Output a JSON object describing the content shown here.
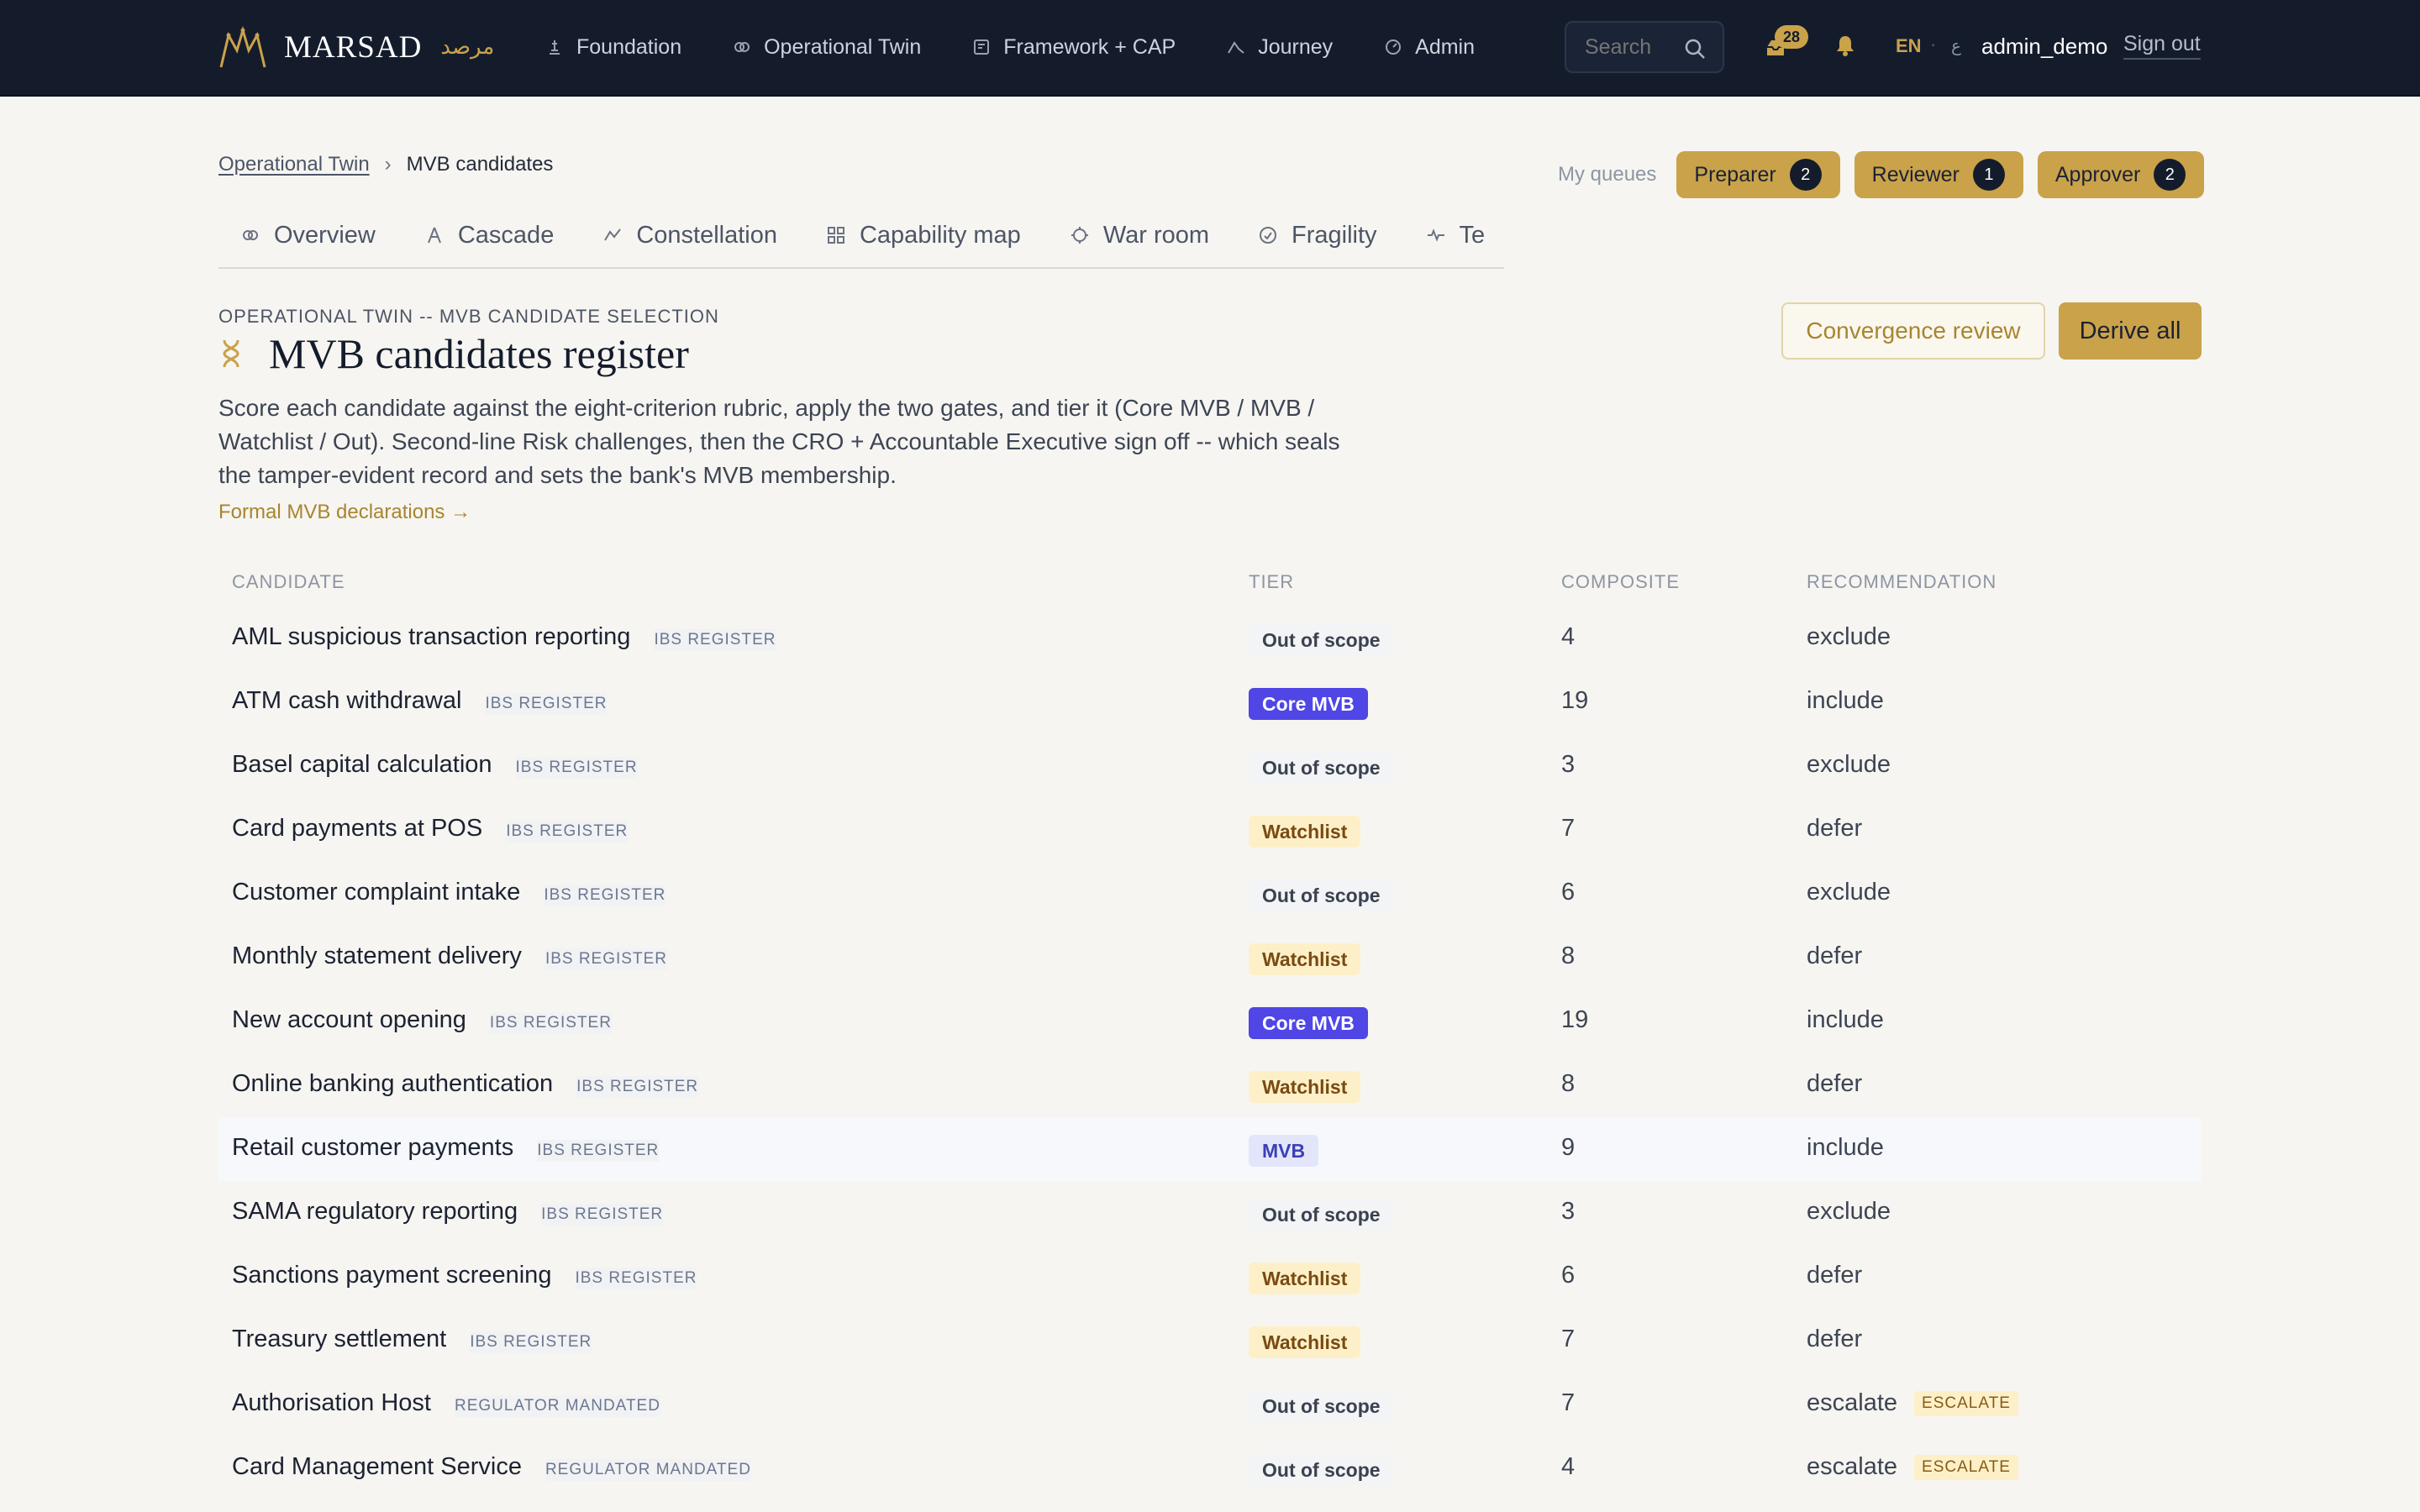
{
  "brand": {
    "name": "MARSAD",
    "arabic": "مرصد"
  },
  "nav": [
    {
      "label": "Foundation",
      "icon": "foundation-icon"
    },
    {
      "label": "Operational Twin",
      "icon": "twin-icon"
    },
    {
      "label": "Framework + CAP",
      "icon": "framework-icon"
    },
    {
      "label": "Journey",
      "icon": "journey-icon"
    },
    {
      "label": "Admin",
      "icon": "admin-icon"
    }
  ],
  "search": {
    "placeholder": "Search"
  },
  "inbox_count": "28",
  "lang": {
    "current": "EN",
    "separator": "·",
    "alt": "ع"
  },
  "user": "admin_demo",
  "signout": "Sign out",
  "breadcrumb": {
    "parent": "Operational Twin",
    "separator": "›",
    "current": "MVB candidates"
  },
  "queues": {
    "label": "My queues",
    "items": [
      {
        "label": "Preparer",
        "count": "2"
      },
      {
        "label": "Reviewer",
        "count": "1"
      },
      {
        "label": "Approver",
        "count": "2"
      }
    ]
  },
  "tabs": [
    {
      "label": "Overview",
      "icon": "overview-icon"
    },
    {
      "label": "Cascade",
      "icon": "cascade-icon"
    },
    {
      "label": "Constellation",
      "icon": "constellation-icon"
    },
    {
      "label": "Capability map",
      "icon": "grid-icon"
    },
    {
      "label": "War room",
      "icon": "crosshair-icon"
    },
    {
      "label": "Fragility",
      "icon": "gauge-icon"
    },
    {
      "label": "Te",
      "icon": "pulse-icon"
    }
  ],
  "header": {
    "eyebrow": "OPERATIONAL TWIN -- MVB CANDIDATE SELECTION",
    "title": "MVB candidates register",
    "description": "Score each candidate against the eight-criterion rubric, apply the two gates, and tier it (Core MVB / MVB / Watchlist / Out). Second-line Risk challenges, then the CRO + Accountable Executive sign off -- which seals the tamper-evident record and sets the bank's MVB membership.",
    "link": "Formal MVB declarations →"
  },
  "actions": {
    "convergence": "Convergence review",
    "derive": "Derive all"
  },
  "table": {
    "headers": {
      "candidate": "CANDIDATE",
      "tier": "TIER",
      "composite": "COMPOSITE",
      "recommendation": "RECOMMENDATION"
    },
    "rows": [
      {
        "name": "AML suspicious transaction reporting",
        "source": "IBS REGISTER",
        "tier": "Out of scope",
        "tier_kind": "out",
        "composite": "4",
        "rec": "exclude",
        "flag": ""
      },
      {
        "name": "ATM cash withdrawal",
        "source": "IBS REGISTER",
        "tier": "Core MVB",
        "tier_kind": "core",
        "composite": "19",
        "rec": "include",
        "flag": ""
      },
      {
        "name": "Basel capital calculation",
        "source": "IBS REGISTER",
        "tier": "Out of scope",
        "tier_kind": "out",
        "composite": "3",
        "rec": "exclude",
        "flag": ""
      },
      {
        "name": "Card payments at POS",
        "source": "IBS REGISTER",
        "tier": "Watchlist",
        "tier_kind": "watch",
        "composite": "7",
        "rec": "defer",
        "flag": ""
      },
      {
        "name": "Customer complaint intake",
        "source": "IBS REGISTER",
        "tier": "Out of scope",
        "tier_kind": "out",
        "composite": "6",
        "rec": "exclude",
        "flag": ""
      },
      {
        "name": "Monthly statement delivery",
        "source": "IBS REGISTER",
        "tier": "Watchlist",
        "tier_kind": "watch",
        "composite": "8",
        "rec": "defer",
        "flag": ""
      },
      {
        "name": "New account opening",
        "source": "IBS REGISTER",
        "tier": "Core MVB",
        "tier_kind": "core",
        "composite": "19",
        "rec": "include",
        "flag": ""
      },
      {
        "name": "Online banking authentication",
        "source": "IBS REGISTER",
        "tier": "Watchlist",
        "tier_kind": "watch",
        "composite": "8",
        "rec": "defer",
        "flag": ""
      },
      {
        "name": "Retail customer payments",
        "source": "IBS REGISTER",
        "tier": "MVB",
        "tier_kind": "mvb",
        "composite": "9",
        "rec": "include",
        "flag": "",
        "highlight": true
      },
      {
        "name": "SAMA regulatory reporting",
        "source": "IBS REGISTER",
        "tier": "Out of scope",
        "tier_kind": "out",
        "composite": "3",
        "rec": "exclude",
        "flag": ""
      },
      {
        "name": "Sanctions payment screening",
        "source": "IBS REGISTER",
        "tier": "Watchlist",
        "tier_kind": "watch",
        "composite": "6",
        "rec": "defer",
        "flag": ""
      },
      {
        "name": "Treasury settlement",
        "source": "IBS REGISTER",
        "tier": "Watchlist",
        "tier_kind": "watch",
        "composite": "7",
        "rec": "defer",
        "flag": ""
      },
      {
        "name": "Authorisation Host",
        "source": "REGULATOR MANDATED",
        "tier": "Out of scope",
        "tier_kind": "out",
        "composite": "7",
        "rec": "escalate",
        "flag": "ESCALATE"
      },
      {
        "name": "Card Management Service",
        "source": "REGULATOR MANDATED",
        "tier": "Out of scope",
        "tier_kind": "out",
        "composite": "4",
        "rec": "escalate",
        "flag": "ESCALATE"
      }
    ]
  }
}
